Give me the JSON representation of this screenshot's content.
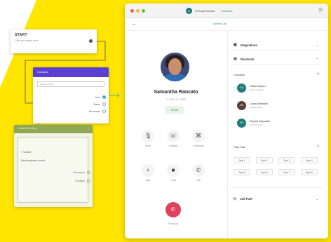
{
  "colors": {
    "yellow": "#ffe500",
    "accent_teal": "#1e7d7c",
    "hangup_red": "#e0425b",
    "flow_purple": "#5b3fd1",
    "flow_green": "#8fa856"
  },
  "flow": {
    "start": {
      "title": "START",
      "subtitle": "Call flow begins here"
    },
    "contacts_card": {
      "title": "Contacts",
      "search_placeholder": "Select contact",
      "options": [
        "Jenn",
        "Danny",
        "No answer"
      ]
    },
    "green_card": {
      "title": "Voice & Routing",
      "field_label": "Transfer",
      "field_text": "Send customer to next",
      "options": [
        "On success",
        "On failure"
      ]
    }
  },
  "window": {
    "app_name": "Hi SuperHandle",
    "status": "Available",
    "active_call": "Active Call",
    "caller": {
      "name": "Samantha Rancato",
      "number": "+1 (312) 111-8597"
    },
    "timer": "00:08",
    "controls": [
      {
        "icon": "mic-icon",
        "glyph": "🎙",
        "label": "Mute"
      },
      {
        "icon": "transfer-icon",
        "glyph": "☏",
        "label": "Transfer"
      },
      {
        "icon": "voicemail-icon",
        "glyph": "⌘",
        "label": "Voicemail"
      },
      {
        "icon": "add-icon",
        "glyph": "+",
        "label": "Add"
      },
      {
        "icon": "stop-icon",
        "glyph": "■",
        "label": "Hold"
      },
      {
        "icon": "call-icon",
        "glyph": "✆",
        "label": "Dial"
      }
    ],
    "hangup_label": "Hang up",
    "panel": {
      "integrations_label": "Integrations",
      "shortcuts_label": "Shortcuts",
      "contacts_label": "Contacts",
      "contacts": [
        {
          "initials": "OD",
          "name": "Olivia Dayton",
          "desc": "Sales manager",
          "photo": false
        },
        {
          "initials": "LM",
          "name": "Lucas Marshall",
          "desc": "Support lead",
          "photo": true
        },
        {
          "initials": "SR",
          "name": "Sophia Reynolds",
          "desc": "Account exec",
          "photo": false
        }
      ],
      "park_call_label": "Park Call",
      "spots": [
        "Spot 1",
        "Spot 2",
        "Spot 3",
        "Spot 4",
        "Spot 5",
        "Spot 6",
        "Spot 7",
        "Spot 8"
      ],
      "callpath_label": "Call Path"
    }
  }
}
